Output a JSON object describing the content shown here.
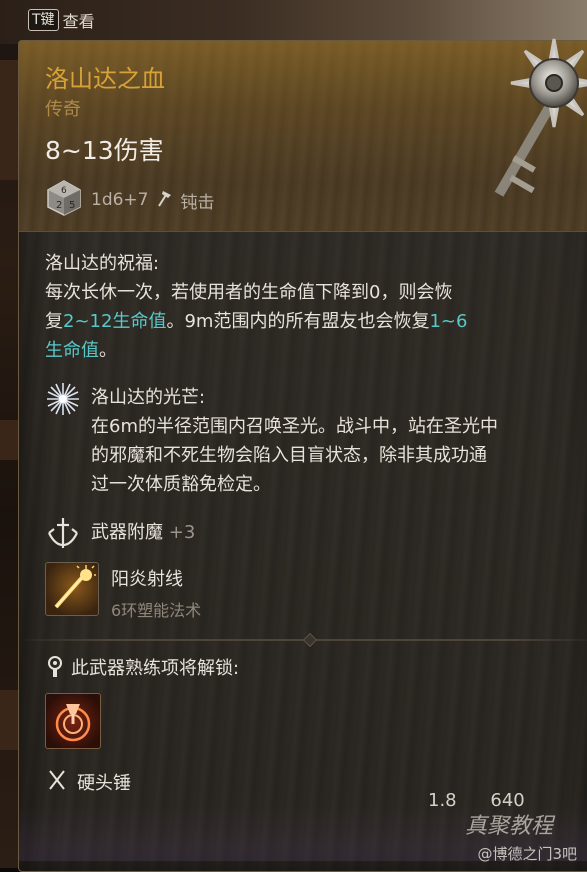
{
  "hint": {
    "key": "T键",
    "label": "查看"
  },
  "item": {
    "name": "洛山达之血",
    "rarity": "传奇",
    "damage": "8~13伤害",
    "dice": "1d6+7",
    "damage_type": "钝击"
  },
  "blessing": {
    "title": "洛山达的祝福:",
    "line1": "每次长休一次，若使用者的生命值下降到0，则会恢",
    "line2_pre": "复",
    "line2_teal1": "2~12生命值",
    "line2_mid": "。9m范围内的所有盟友也会恢复",
    "line2_teal2": "1~6",
    "line3_teal": "生命值",
    "line3_post": "。"
  },
  "radiance": {
    "title": "洛山达的光芒:",
    "line1": "在6m的半径范围内召唤圣光。战斗中，站在圣光中",
    "line2": "的邪魔和不死生物会陷入目盲状态，除非其成功通",
    "line3": "过一次体质豁免检定。"
  },
  "enchant": {
    "label": "武器附魔",
    "value": "+3"
  },
  "spell": {
    "name": "阳炎射线",
    "level": "6环塑能法术"
  },
  "proficiency": {
    "title": "此武器熟练项将解锁:"
  },
  "weapon_class": {
    "label": "硬头锤"
  },
  "footer": {
    "weight": "1.8",
    "price": "640"
  },
  "watermark": {
    "big": "真聚教程",
    "small": "@博德之门3吧"
  },
  "colors": {
    "title_gold": "#d8a238",
    "rarity": "#b08a45",
    "highlight": "#58c9c9",
    "text": "#e7e2da"
  }
}
